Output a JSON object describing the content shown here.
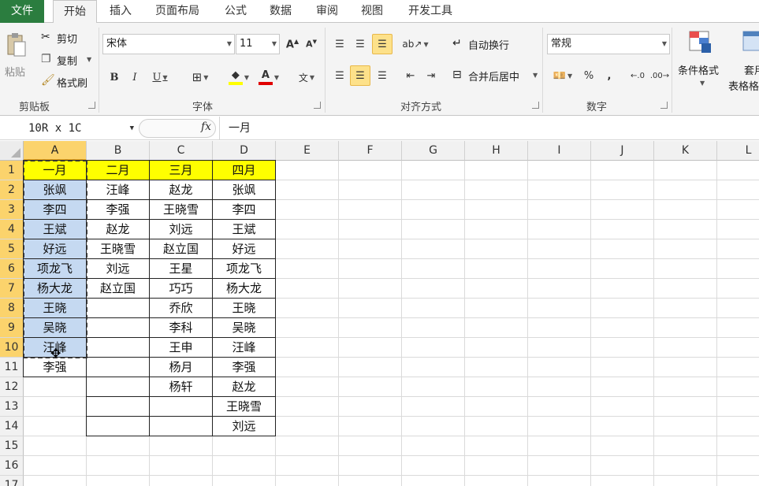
{
  "tabs": [
    {
      "label": "文件"
    },
    {
      "label": "开始"
    },
    {
      "label": "插入"
    },
    {
      "label": "页面布局"
    },
    {
      "label": "公式"
    },
    {
      "label": "数据"
    },
    {
      "label": "审阅"
    },
    {
      "label": "视图"
    },
    {
      "label": "开发工具"
    }
  ],
  "ribbon": {
    "clipboard": {
      "paste": "粘贴",
      "cut": "剪切",
      "copy": "复制",
      "format_painter": "格式刷",
      "group_label": "剪贴板"
    },
    "font": {
      "font_name": "宋体",
      "font_size": "11",
      "group_label": "字体"
    },
    "alignment": {
      "wrap_text": "自动换行",
      "merge_center": "合并后居中",
      "group_label": "对齐方式"
    },
    "number": {
      "format": "常规",
      "percent": "%",
      "comma": ",",
      "group_label": "数字"
    },
    "styles": {
      "conditional_format": "条件格式",
      "table_partial": "套用",
      "table_partial2": "表格格"
    }
  },
  "formula_bar": {
    "name_box": "10R x 1C",
    "fx": "fx",
    "content": "一月"
  },
  "columns": [
    "A",
    "B",
    "C",
    "D",
    "E",
    "F",
    "G",
    "H",
    "I",
    "J",
    "K",
    "L"
  ],
  "rows": [
    "1",
    "2",
    "3",
    "4",
    "5",
    "6",
    "7",
    "8",
    "9",
    "10",
    "11",
    "12",
    "13",
    "14",
    "15",
    "16",
    "17"
  ],
  "cells": {
    "A": [
      "一月",
      "张飒",
      "李四",
      "王斌",
      "好远",
      "项龙飞",
      "杨大龙",
      "王晓",
      "吴晓",
      "汪峰",
      "李强",
      "",
      "",
      ""
    ],
    "B": [
      "二月",
      "汪峰",
      "李强",
      "赵龙",
      "王晓雪",
      "刘远",
      "赵立国",
      "",
      "",
      "",
      "",
      "",
      "",
      ""
    ],
    "C": [
      "三月",
      "赵龙",
      "王晓雪",
      "刘远",
      "赵立国",
      "王星",
      "巧巧",
      "乔欣",
      "李科",
      "王申",
      "杨月",
      "杨轩",
      "",
      ""
    ],
    "D": [
      "四月",
      "张飒",
      "李四",
      "王斌",
      "好远",
      "项龙飞",
      "杨大龙",
      "王晓",
      "吴晓",
      "汪峰",
      "李强",
      "赵龙",
      "王晓雪",
      "刘远"
    ]
  },
  "colors": {
    "file_tab": "#2b7d3f",
    "header_fill": "#ffff00",
    "selection_fill": "#c5d9f1",
    "header_highlight": "#fbd36c"
  }
}
